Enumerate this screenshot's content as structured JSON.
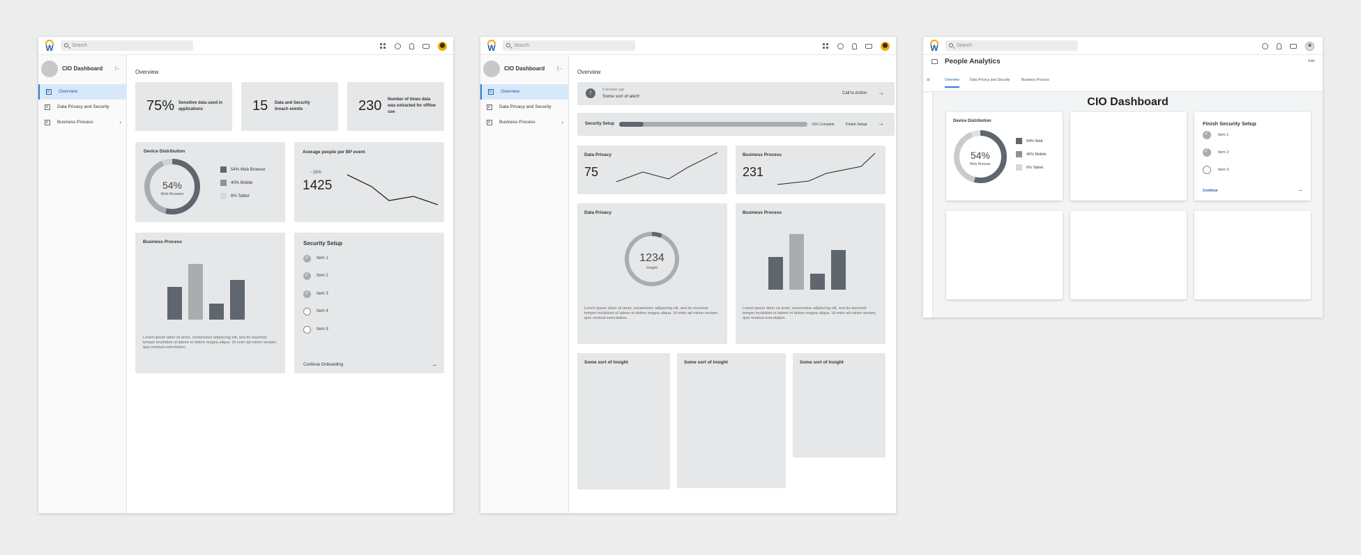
{
  "common": {
    "app_title": "CIO Dashboard",
    "search_placeholder": "Search",
    "overview_heading": "Overview",
    "nav": [
      {
        "label": "Overview"
      },
      {
        "label": "Data Privacy and Security"
      },
      {
        "label": "Business Process"
      }
    ],
    "colors": {
      "dark_bar": "#5f666d",
      "light_bar": "#a9acb0",
      "accent": "#2a7bd4",
      "card_bg": "#e5e7e9"
    }
  },
  "frame1": {
    "kpis": [
      {
        "value": "75%",
        "label": "Sensitive data used in applications"
      },
      {
        "value": "15",
        "label": "Data and Security breach events"
      },
      {
        "value": "230",
        "label": "Number of times data was extracted for offline use"
      }
    ],
    "device": {
      "title": "Device Distribution",
      "center_value": "54%",
      "center_label": "Web Browser",
      "legend": [
        "54% Web Browser",
        "40% Mobile",
        "6%  Tablet"
      ]
    },
    "avg": {
      "title": "Average people per BP event",
      "delta": "- 15%",
      "value": "1425"
    },
    "bp": {
      "title": "Business Process",
      "text": "Lorem ipsum dolor sit amet, consectetur adipiscing elit, sed do eiusmod tempor incididunt ut labore et dolore magna aliqua. Ut enim ad minim veniam, quis nostrud exercitation."
    },
    "security": {
      "title": "Security Setup",
      "items": [
        "Item 1",
        "Item 2",
        "Item 3",
        "Item 4",
        "Item 5"
      ],
      "done_count": 3,
      "link": "Continue Onboarding"
    }
  },
  "frame2": {
    "alert": {
      "time": "5 minutes ago",
      "message": "Some sort of alert!",
      "cta": "Call to Action"
    },
    "setup": {
      "label": "Security Setup",
      "progress_text": "10% Complete",
      "progress": 0.13,
      "finish": "Finish Setup"
    },
    "data_privacy_kpi": {
      "title": "Data Privacy",
      "value": "75"
    },
    "bp_kpi": {
      "title": "Business Process",
      "value": "231"
    },
    "dp_card": {
      "title": "Data Privacy",
      "center_value": "1234",
      "center_label": "Insight",
      "text": "Lorem ipsum dolor sit amet, consectetur adipiscing elit, sed do eiusmod tempor incididunt ut labore et dolore magna aliqua. Ut enim ad minim veniam, quis nostrud exercitation."
    },
    "bp_card": {
      "title": "Business Process",
      "text": "Lorem ipsum dolor sit amet, consectetur adipiscing elit, sed do eiusmod tempor incididunt ut labore et dolore magna aliqua. Ut enim ad minim veniam, quis nostrud exercitation."
    },
    "insights": [
      "Some sort of Insight",
      "Some sort of Insight",
      "Some sort of Insight"
    ]
  },
  "frame3": {
    "header_title": "People Analytics",
    "header_link": "Edit",
    "tabs": [
      "Overview",
      "Data Privacy and Security",
      "Business Process"
    ],
    "dashboard_title": "CIO Dashboard",
    "device": {
      "title": "Device Distribution",
      "center_value": "54%",
      "center_label": "Web Browser",
      "legend": [
        "54% Web",
        "40% Mobile",
        "6%  Tablet"
      ]
    },
    "finish": {
      "title": "Finish Security Setup",
      "items": [
        "Item 1",
        "Item 2",
        "Item 3"
      ],
      "link": "Continue"
    }
  }
}
